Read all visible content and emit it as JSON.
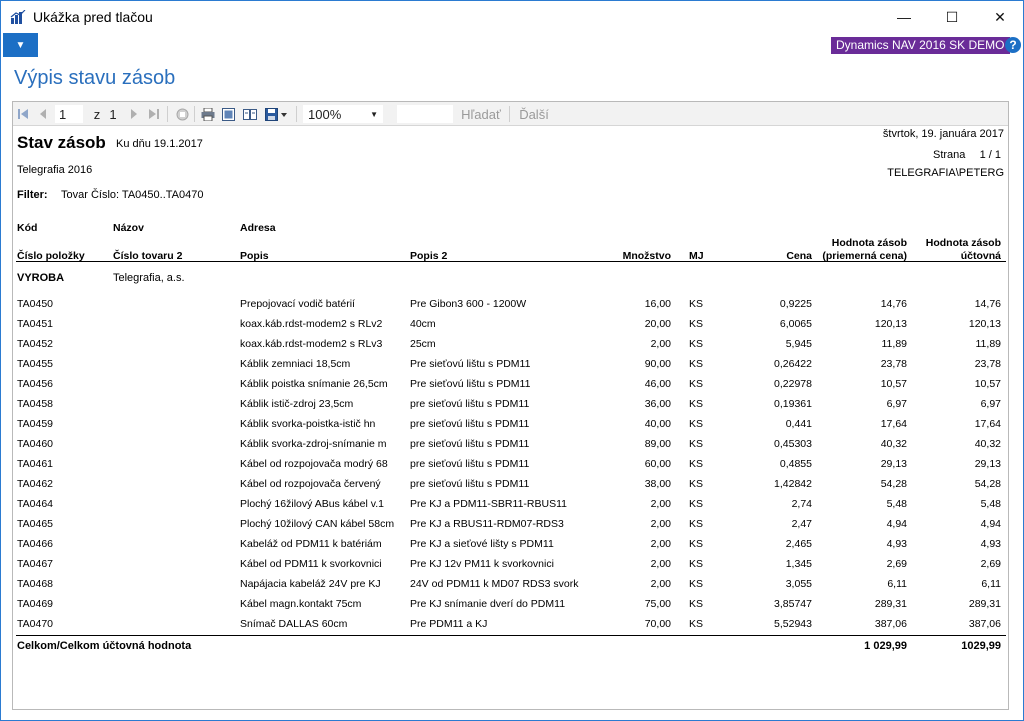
{
  "window": {
    "title": "Ukážka pred tlačou",
    "minimize_glyph": "—",
    "maximize_glyph": "☐",
    "close_glyph": "✕",
    "brand": "Dynamics NAV 2016 SK DEMO",
    "help_glyph": "?",
    "menu_glyph": "▼",
    "accent_color": "#1c6fc5",
    "brand_color": "#6a2c98"
  },
  "page": {
    "heading": "Výpis stavu zásob"
  },
  "toolbar": {
    "page_value": "1",
    "of_label": "z",
    "total_pages": "1",
    "zoom_value": "100%",
    "find_label": "Hľadať",
    "next_label": "Ďalší",
    "icons": [
      "first-page-icon",
      "previous-page-icon",
      "next-page-icon",
      "last-page-icon",
      "stop-icon",
      "print-icon",
      "print-layout-icon",
      "page-setup-icon",
      "export-icon"
    ]
  },
  "report": {
    "title": "Stav zásob",
    "as_of": "Ku dňu 19.1.2017",
    "print_date": "štvrtok, 19. januára 2017",
    "page_label": "Strana",
    "page_value": "1 / 1",
    "user": "TELEGRAFIA\\PETERG",
    "company": "Telegrafia 2016",
    "filter_label": "Filter:",
    "filter_value": "Tovar Číslo: TA0450..TA0470",
    "headers": {
      "code": "Kód",
      "name": "Názov",
      "address": "Adresa",
      "item_no": "Číslo položky",
      "item_no2": "Číslo tovaru 2",
      "description": "Popis",
      "description2": "Popis 2",
      "quantity": "Množstvo",
      "uom": "MJ",
      "cost": "Cena",
      "value_avg": "Hodnota zásob\n(priemerná cena)",
      "value_book": "Hodnota zásob\núčtovná"
    },
    "group": {
      "code": "VYROBA",
      "name": "Telegrafia, a.s."
    },
    "rows": [
      [
        "TA0450",
        "Prepojovací vodič batérií",
        "Pre Gibon3 600 - 1200W",
        "16,00",
        "KS",
        "0,9225",
        "14,76",
        "14,76"
      ],
      [
        "TA0451",
        "koax.káb.rdst-modem2 s RLv2",
        "40cm",
        "20,00",
        "KS",
        "6,0065",
        "120,13",
        "120,13"
      ],
      [
        "TA0452",
        "koax.káb.rdst-modem2 s RLv3",
        "25cm",
        "2,00",
        "KS",
        "5,945",
        "11,89",
        "11,89"
      ],
      [
        "TA0455",
        "Káblik zemniaci 18,5cm",
        "Pre sieťovú lištu s PDM11",
        "90,00",
        "KS",
        "0,26422",
        "23,78",
        "23,78"
      ],
      [
        "TA0456",
        "Káblik poistka snímanie 26,5cm",
        "Pre sieťovú lištu s PDM11",
        "46,00",
        "KS",
        "0,22978",
        "10,57",
        "10,57"
      ],
      [
        "TA0458",
        "Káblik istič-zdroj 23,5cm",
        "pre sieťovú lištu s PDM11",
        "36,00",
        "KS",
        "0,19361",
        "6,97",
        "6,97"
      ],
      [
        "TA0459",
        "Káblik svorka-poistka-istič hn",
        "pre sieťovú lištu s PDM11",
        "40,00",
        "KS",
        "0,441",
        "17,64",
        "17,64"
      ],
      [
        "TA0460",
        "Káblik svorka-zdroj-snímanie m",
        "pre sieťovú lištu s PDM11",
        "89,00",
        "KS",
        "0,45303",
        "40,32",
        "40,32"
      ],
      [
        "TA0461",
        "Kábel od rozpojovača  modrý 68",
        "pre sieťovú lištu s PDM11",
        "60,00",
        "KS",
        "0,4855",
        "29,13",
        "29,13"
      ],
      [
        "TA0462",
        "Kábel od rozpojovača červený",
        "pre sieťovú lištu s PDM11",
        "38,00",
        "KS",
        "1,42842",
        "54,28",
        "54,28"
      ],
      [
        "TA0464",
        "Plochý 16žilový ABus kábel v.1",
        "Pre KJ a PDM11-SBR11-RBUS11",
        "2,00",
        "KS",
        "2,74",
        "5,48",
        "5,48"
      ],
      [
        "TA0465",
        "Plochý 10žilový CAN kábel 58cm",
        "Pre KJ a RBUS11-RDM07-RDS3",
        "2,00",
        "KS",
        "2,47",
        "4,94",
        "4,94"
      ],
      [
        "TA0466",
        "Kabeláž od PDM11 k batériám",
        "Pre KJ a sieťové lišty s PDM11",
        "2,00",
        "KS",
        "2,465",
        "4,93",
        "4,93"
      ],
      [
        "TA0467",
        "Kábel od PDM11 k svorkovnici",
        "Pre KJ 12v  PM11 k svorkovnici",
        "2,00",
        "KS",
        "1,345",
        "2,69",
        "2,69"
      ],
      [
        "TA0468",
        "Napájacia kabeláž 24V pre KJ",
        "24V od PDM11 k MD07 RDS3 svork",
        "2,00",
        "KS",
        "3,055",
        "6,11",
        "6,11"
      ],
      [
        "TA0469",
        "Kábel magn.kontakt 75cm",
        "Pre KJ snímanie dverí do PDM11",
        "75,00",
        "KS",
        "3,85747",
        "289,31",
        "289,31"
      ],
      [
        "TA0470",
        "Snímač DALLAS 60cm",
        "Pre PDM11 a KJ",
        "70,00",
        "KS",
        "5,52943",
        "387,06",
        "387,06"
      ]
    ],
    "total_label": "Celkom/Celkom účtovná hodnota",
    "total_avg": "1 029,99",
    "total_book": "1029,99"
  }
}
